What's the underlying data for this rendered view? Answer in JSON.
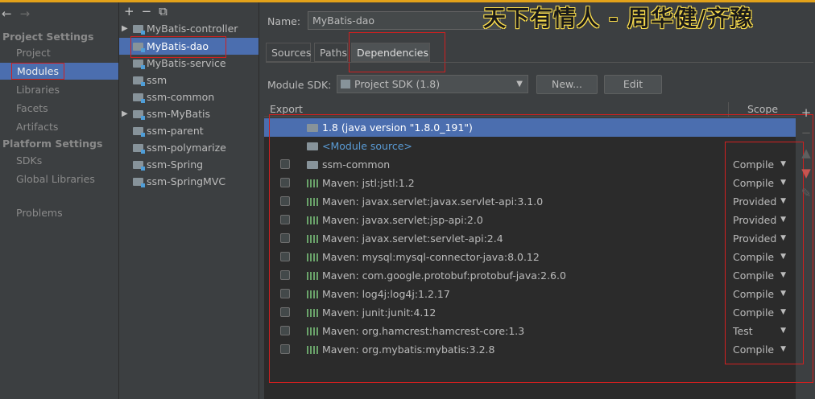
{
  "nav": {
    "back": "←",
    "forward": "→",
    "project_settings_header": "Project Settings",
    "project_items": [
      "Project",
      "Modules",
      "Libraries",
      "Facets",
      "Artifacts"
    ],
    "platform_settings_header": "Platform Settings",
    "platform_items": [
      "SDKs",
      "Global Libraries"
    ],
    "problems": "Problems",
    "selected": "Modules"
  },
  "tree": {
    "tools": [
      "+",
      "−",
      "⧉"
    ],
    "items": [
      "MyBatis-controller",
      "MyBatis-dao",
      "MyBatis-service",
      "ssm",
      "ssm-common",
      "ssm-MyBatis",
      "ssm-parent",
      "ssm-polymarize",
      "ssm-Spring",
      "ssm-SpringMVC"
    ],
    "selected": "MyBatis-dao"
  },
  "main": {
    "name_label": "Name:",
    "name_value": "MyBatis-dao",
    "watermark": "天下有情人 - 周华健/齐豫",
    "tabs": [
      "Sources",
      "Paths",
      "Dependencies"
    ],
    "active_tab": "Dependencies",
    "sdk_label": "Module SDK:",
    "sdk_value": "Project SDK (1.8)",
    "new_button": "New...",
    "edit_button": "Edit"
  },
  "table": {
    "header_export": "Export",
    "header_scope": "Scope",
    "rows": [
      {
        "name": "1.8 (java version \"1.8.0_191\")",
        "scope": "",
        "kind": "jdk"
      },
      {
        "name": "<Module source>",
        "scope": "",
        "kind": "source"
      },
      {
        "name": "ssm-common",
        "scope": "Compile",
        "kind": "module"
      },
      {
        "name": "Maven: jstl:jstl:1.2",
        "scope": "Compile",
        "kind": "lib"
      },
      {
        "name": "Maven: javax.servlet:javax.servlet-api:3.1.0",
        "scope": "Provided",
        "kind": "lib"
      },
      {
        "name": "Maven: javax.servlet:jsp-api:2.0",
        "scope": "Provided",
        "kind": "lib"
      },
      {
        "name": "Maven: javax.servlet:servlet-api:2.4",
        "scope": "Provided",
        "kind": "lib"
      },
      {
        "name": "Maven: mysql:mysql-connector-java:8.0.12",
        "scope": "Compile",
        "kind": "lib"
      },
      {
        "name": "Maven: com.google.protobuf:protobuf-java:2.6.0",
        "scope": "Compile",
        "kind": "lib"
      },
      {
        "name": "Maven: log4j:log4j:1.2.17",
        "scope": "Compile",
        "kind": "lib"
      },
      {
        "name": "Maven: junit:junit:4.12",
        "scope": "Compile",
        "kind": "lib"
      },
      {
        "name": "Maven: org.hamcrest:hamcrest-core:1.3",
        "scope": "Test",
        "kind": "lib"
      },
      {
        "name": "Maven: org.mybatis:mybatis:3.2.8",
        "scope": "Compile",
        "kind": "lib"
      }
    ],
    "side_tools": [
      "+",
      "−",
      "▲",
      "▼",
      "✎"
    ]
  },
  "colors": {
    "background": "#3c3f41",
    "selection": "#4b6eaf",
    "highlight_box": "#d02020",
    "module_source_link": "#5a9bd5"
  }
}
